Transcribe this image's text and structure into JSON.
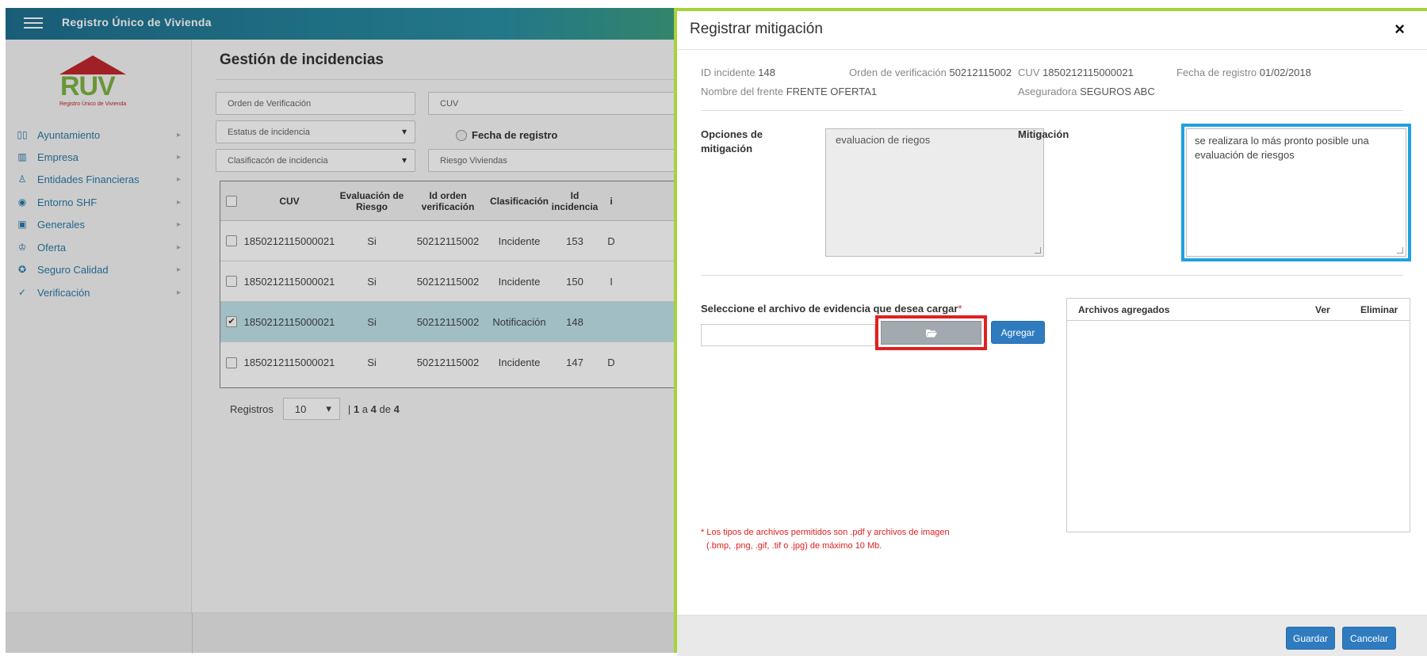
{
  "app": {
    "title": "Registro Único de Vivienda"
  },
  "logo": {
    "word": "RUV",
    "tagline": "Registro Único de Vivienda"
  },
  "sidebar": {
    "items": [
      {
        "label": "Ayuntamiento",
        "icon": "map-icon"
      },
      {
        "label": "Empresa",
        "icon": "building-icon"
      },
      {
        "label": "Entidades Financieras",
        "icon": "people-icon"
      },
      {
        "label": "Entorno SHF",
        "icon": "target-icon"
      },
      {
        "label": "Generales",
        "icon": "document-icon"
      },
      {
        "label": "Oferta",
        "icon": "user-icon"
      },
      {
        "label": "Seguro Calidad",
        "icon": "seal-icon"
      },
      {
        "label": "Verificación",
        "icon": "check-circle-icon"
      }
    ]
  },
  "main": {
    "title": "Gestión de incidencias",
    "filters": {
      "orden_placeholder": "Orden de Verificación",
      "cuv_placeholder": "CUV",
      "estatus": "Estatus de incidencia",
      "fecha_label": "Fecha de registro",
      "clasificacion": "Clasificacón de incidencia",
      "riesgo": "Riesgo Viviendas"
    },
    "grid": {
      "headers": {
        "cuv": "CUV",
        "evaluacion": "Evaluación de Riesgo",
        "orden": "Id orden verificación",
        "clasificacion": "Clasificación",
        "incidencia": "Id incidencia",
        "extra": "i"
      },
      "rows": [
        {
          "checked": false,
          "cuv": "1850212115000021",
          "evaluacion": "Si",
          "orden": "50212115002",
          "clasificacion": "Incidente",
          "incidencia": "153",
          "extra": "D"
        },
        {
          "checked": false,
          "cuv": "1850212115000021",
          "evaluacion": "Si",
          "orden": "50212115002",
          "clasificacion": "Incidente",
          "incidencia": "150",
          "extra": "I"
        },
        {
          "checked": true,
          "cuv": "1850212115000021",
          "evaluacion": "Si",
          "orden": "50212115002",
          "clasificacion": "Notificación",
          "incidencia": "148",
          "extra": ""
        },
        {
          "checked": false,
          "cuv": "1850212115000021",
          "evaluacion": "Si",
          "orden": "50212115002",
          "clasificacion": "Incidente",
          "incidencia": "147",
          "extra": "D"
        }
      ]
    },
    "paging": {
      "label": "Registros",
      "page_size": "10",
      "sep": "|",
      "from": "1",
      "a": "a",
      "to": "4",
      "de": "de",
      "total": "4"
    }
  },
  "modal": {
    "title": "Registrar mitigación",
    "close_icon": "×",
    "info": {
      "id_label": "ID incidente",
      "id_value": "148",
      "orden_label": "Orden de verificación",
      "orden_value": "50212115002",
      "cuv_label": "CUV",
      "cuv_value": "1850212115000021",
      "fecha_label": "Fecha de registro",
      "fecha_value": "01/02/2018",
      "frente_label": "Nombre del frente",
      "frente_value": "FRENTE OFERTA1",
      "aseguradora_label": "Aseguradora",
      "aseguradora_value": "SEGUROS ABC"
    },
    "opciones_label": "Opciones de mitigación",
    "opciones_value": "evaluacion de riegos",
    "mitigacion_label": "Mitigación",
    "mitigacion_value": "se realizara lo más pronto posible una evaluación de riesgos",
    "file_label": "Seleccione el archivo de evidencia que desea cargar",
    "required_mark": "*",
    "agregar": "Agregar",
    "files_table": {
      "col_files": "Archivos agregados",
      "col_ver": "Ver",
      "col_eliminar": "Eliminar"
    },
    "note_line1": "* Los tipos de archivos permitidos son .pdf y archivos de imagen",
    "note_line2": "(.bmp, .png, .gif, .tif o .jpg) de máximo 10 Mb.",
    "guardar": "Guardar",
    "cancelar": "Cancelar"
  },
  "colors": {
    "accent_blue": "#2f7bbf",
    "modal_border": "#a6d23a",
    "highlight_blue": "#1fa1e0",
    "highlight_red": "#e02020"
  }
}
